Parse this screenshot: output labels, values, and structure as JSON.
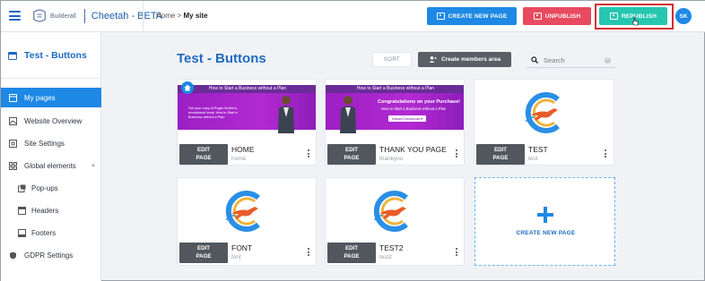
{
  "app": {
    "logo_text": "Builderall",
    "title": "Cheetah - BETA"
  },
  "breadcrumb": {
    "home": "Home",
    "separator": ">",
    "current": "My site"
  },
  "toolbar": {
    "create_new_page": "CREATE NEW PAGE",
    "unpublish": "UNPUBLISH",
    "republish": "REPUBLISH",
    "avatar_initials": "SK"
  },
  "sidebar": {
    "site_title": "Test - Buttons",
    "items": [
      {
        "label": "My pages",
        "icon": "pages-icon",
        "active": true
      },
      {
        "label": "Website Overview",
        "icon": "overview-icon"
      },
      {
        "label": "Site Settings",
        "icon": "settings-icon"
      },
      {
        "label": "Global elements",
        "icon": "global-elements-icon",
        "expanded": true
      },
      {
        "label": "Pop-ups",
        "icon": "popup-icon",
        "sub": true
      },
      {
        "label": "Headers",
        "icon": "header-icon",
        "sub": true
      },
      {
        "label": "Footers",
        "icon": "footer-icon",
        "sub": true
      },
      {
        "label": "GDPR Settings",
        "icon": "shield-icon"
      }
    ]
  },
  "main": {
    "heading": "Test - Buttons",
    "sort_label": "SORT",
    "members_label": "Create members area",
    "search_placeholder": "Search",
    "edit_label_line1": "EDIT",
    "edit_label_line2": "PAGE",
    "new_page_label": "CREATE NEW PAGE",
    "pages": [
      {
        "name": "HOME",
        "slug": "home",
        "thumb": "home",
        "thumb_title": "How to Start a Business without a Plan",
        "thumb_text": "Get your copy of Roger Mullen's exceptional book: How to Start a Business without a Plan"
      },
      {
        "name": "THANK YOU PAGE",
        "slug": "thankyou",
        "thumb": "thankyou",
        "thumb_title": "How to Start a Business without a Plan",
        "thumb_heading": "Congratulations on your Purchase!",
        "thumb_sub": "How to Start a Business without a Plan",
        "thumb_button": "Instant Download ▾"
      },
      {
        "name": "TEST",
        "slug": "test",
        "thumb": "logo"
      },
      {
        "name": "FONT",
        "slug": "font",
        "thumb": "logo"
      },
      {
        "name": "TEST2",
        "slug": "test2",
        "thumb": "logo"
      }
    ]
  },
  "colors": {
    "primary": "#1e88e5",
    "unpublish": "#e84a5f",
    "republish": "#26c6b0",
    "highlight": "#d32f2f",
    "banner": "#a524cc"
  }
}
